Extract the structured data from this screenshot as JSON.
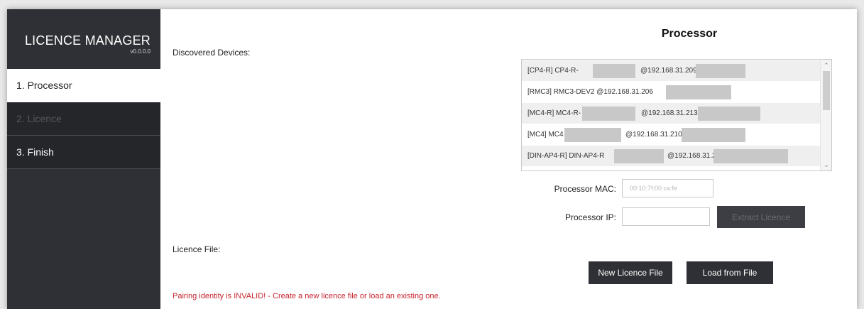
{
  "app": {
    "title": "LICENCE MANAGER",
    "version": "v0.0.0.0"
  },
  "nav": {
    "items": [
      {
        "label": "1. Processor",
        "state": "active"
      },
      {
        "label": "2. Licence",
        "state": "disabled"
      },
      {
        "label": "3. Finish",
        "state": "normal"
      }
    ]
  },
  "main": {
    "heading": "Processor",
    "discovered_label": "Discovered Devices:",
    "devices": [
      {
        "prefix": "[CP4-R] CP4-R-",
        "ip": "@192.168.31.209"
      },
      {
        "prefix": "[RMC3] RMC3-DEV2 @192.168.31.206",
        "ip": ""
      },
      {
        "prefix": "[MC4-R] MC4-R-",
        "ip": "@192.168.31.213"
      },
      {
        "prefix": "[MC4] MC4",
        "ip": "@192.168.31.210"
      },
      {
        "prefix": "[DIN-AP4-R] DIN-AP4-R",
        "ip": "@192.168.31.205"
      }
    ],
    "mac_label": "Processor MAC:",
    "mac_value": "00:10:7f:00:ca:fe",
    "ip_label": "Processor IP:",
    "ip_value": "",
    "extract_button": "Extract Licence",
    "licence_file_label": "Licence File:",
    "new_licence_button": "New Licence File",
    "load_button": "Load from File",
    "error_message": "Pairing identity is INVALID! - Create a new licence file or load an existing one."
  },
  "colors": {
    "sidebar": "#2f3035",
    "error": "#c8242e",
    "redaction": "#c8c8c8"
  }
}
